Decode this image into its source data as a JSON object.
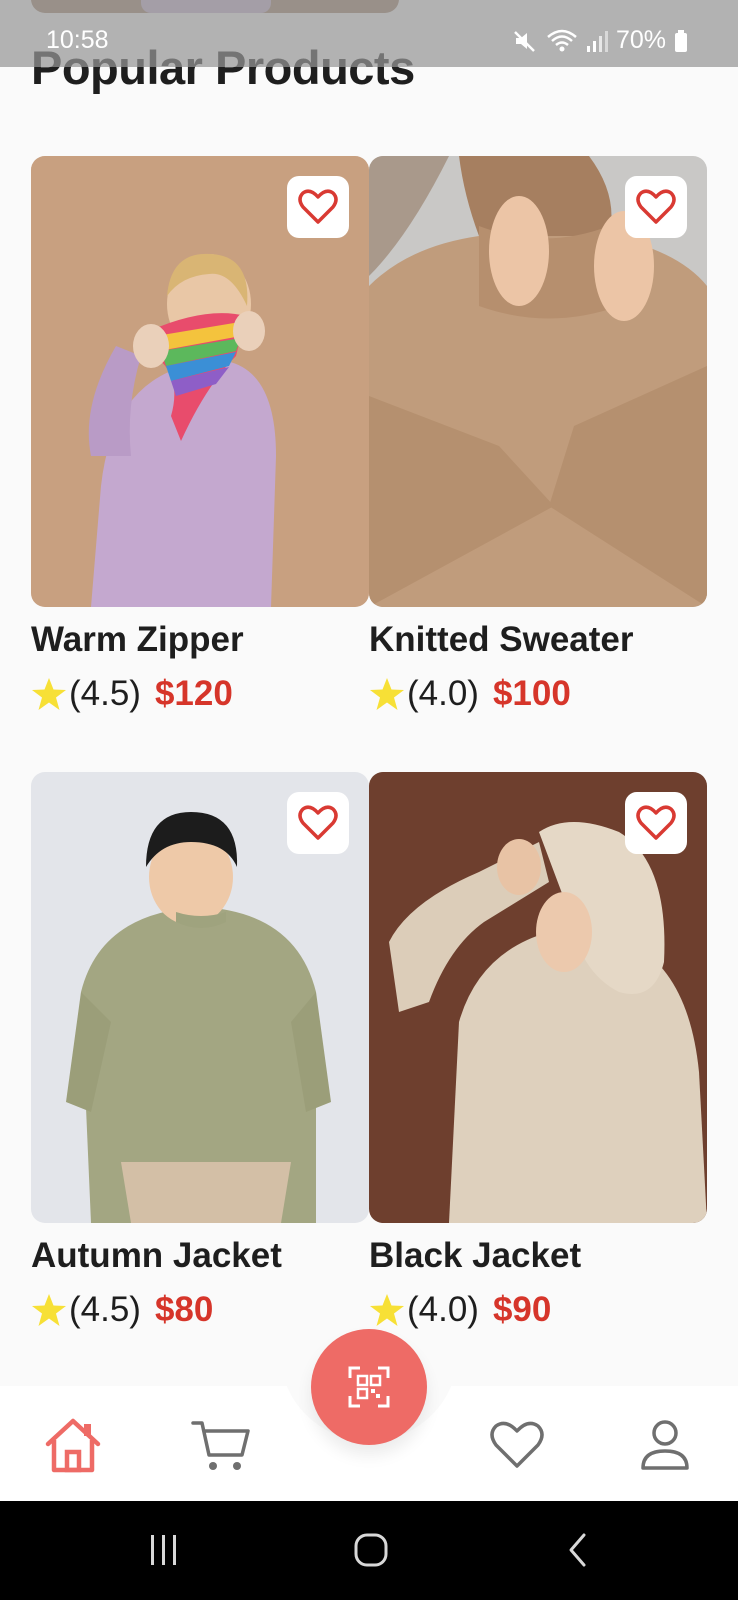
{
  "status_bar": {
    "time": "10:58",
    "battery": "70%",
    "icons": [
      "mute-icon",
      "wifi-icon",
      "signal-icon",
      "battery-icon"
    ]
  },
  "page": {
    "title": "Popular Products"
  },
  "colors": {
    "accent": "#ee6b66",
    "price": "#d6352a",
    "star": "#f7e036",
    "heart": "#d93a33",
    "background": "#fafafa"
  },
  "products": [
    {
      "name": "Warm Zipper",
      "rating": "(4.5)",
      "price": "$120",
      "favorite_icon": "heart-outline-icon"
    },
    {
      "name": "Knitted Sweater",
      "rating": "(4.0)",
      "price": "$100",
      "favorite_icon": "heart-outline-icon"
    },
    {
      "name": "Autumn Jacket",
      "rating": "(4.5)",
      "price": "$80",
      "favorite_icon": "heart-outline-icon"
    },
    {
      "name": "Black Jacket",
      "rating": "(4.0)",
      "price": "$90",
      "favorite_icon": "heart-outline-icon"
    }
  ],
  "bottom_nav": {
    "items": [
      {
        "icon": "home-icon",
        "active": true
      },
      {
        "icon": "cart-icon",
        "active": false
      },
      {
        "icon": "qr-scan-icon",
        "active": false
      },
      {
        "icon": "heart-icon",
        "active": false
      },
      {
        "icon": "profile-icon",
        "active": false
      }
    ]
  },
  "system_nav": {
    "buttons": [
      "recent-apps-icon",
      "home-circle-icon",
      "back-icon"
    ]
  }
}
